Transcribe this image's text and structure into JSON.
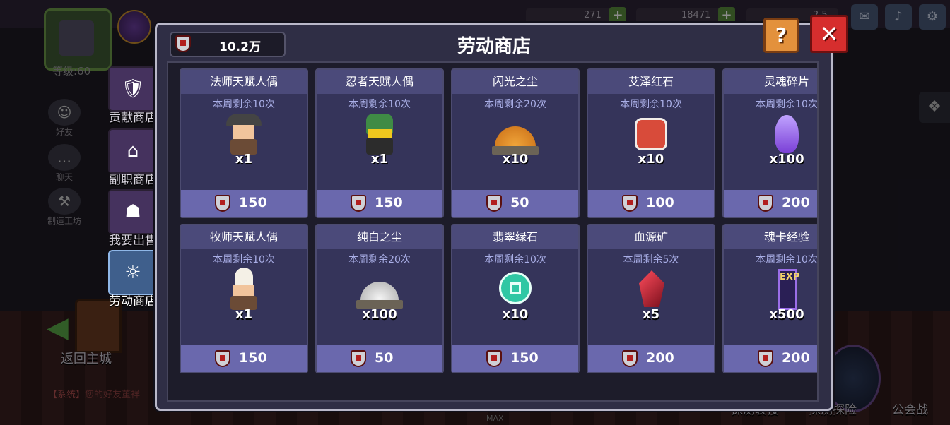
{
  "background": {
    "player": {
      "level_text": "等级:60"
    },
    "resources": [
      {
        "icon": "pink-gem-icon",
        "value": "271"
      },
      {
        "icon": "blue-gem-icon",
        "value": "18471"
      },
      {
        "icon": "gold-coin-icon",
        "value": "2.5"
      }
    ],
    "side_buttons_small": [
      {
        "id": "friends",
        "label": "好友",
        "icon": "friends-icon"
      },
      {
        "id": "chat",
        "label": "聊天",
        "icon": "chat-bubble-icon"
      },
      {
        "id": "workshop",
        "label": "制造工坊",
        "icon": "hammer-icon"
      }
    ],
    "back_label": "返回主城",
    "system_message": {
      "tag": "【系统】",
      "text": "您的好友董祥"
    },
    "bottom_tabs": [
      "探测装搜",
      "探测探险",
      "公会战"
    ],
    "max_label": "MAX"
  },
  "shop_nav": [
    {
      "label": "贡献商店",
      "icon": "contribution-shop-icon",
      "active": false
    },
    {
      "label": "副职商店",
      "icon": "side-job-shop-icon",
      "active": false
    },
    {
      "label": "我要出售",
      "icon": "sell-icon",
      "active": false
    },
    {
      "label": "劳动商店",
      "icon": "labor-shop-icon",
      "active": true
    }
  ],
  "shop": {
    "title": "劳动商店",
    "currency_value": "10.2万",
    "help_label": "?",
    "close_label": "✕",
    "items": [
      {
        "name": "法师天赋人偶",
        "limit": "本周剩余10次",
        "icon": "mage-doll-icon",
        "qty": "x1",
        "price": "150"
      },
      {
        "name": "忍者天赋人偶",
        "limit": "本周剩余10次",
        "icon": "ninja-doll-icon",
        "qty": "x1",
        "price": "150"
      },
      {
        "name": "闪光之尘",
        "limit": "本周剩余20次",
        "icon": "glitter-dust-icon",
        "qty": "x10",
        "price": "50"
      },
      {
        "name": "艾泽红石",
        "limit": "本周剩余10次",
        "icon": "red-stone-icon",
        "qty": "x10",
        "price": "100"
      },
      {
        "name": "灵魂碎片",
        "limit": "本周剩余10次",
        "icon": "soul-fragment-icon",
        "qty": "x100",
        "price": "200"
      },
      {
        "name": "牧师天赋人偶",
        "limit": "本周剩余10次",
        "icon": "priest-doll-icon",
        "qty": "x1",
        "price": "150"
      },
      {
        "name": "纯白之尘",
        "limit": "本周剩余20次",
        "icon": "white-dust-icon",
        "qty": "x100",
        "price": "50"
      },
      {
        "name": "翡翠绿石",
        "limit": "本周剩余10次",
        "icon": "emerald-stone-icon",
        "qty": "x10",
        "price": "150"
      },
      {
        "name": "血源矿",
        "limit": "本周剩余5次",
        "icon": "blood-ore-icon",
        "qty": "x5",
        "price": "200"
      },
      {
        "name": "魂卡经验",
        "limit": "本周剩余10次",
        "icon": "exp-card-icon",
        "qty": "x500",
        "price": "200",
        "icon_text": "EXP"
      }
    ]
  },
  "colors": {
    "panel_bg": "#2f2e45",
    "card_bg": "#35345a",
    "card_title_bg": "#4b4a7a",
    "price_bar": "#6a68ad",
    "limit_text": "#a9aee6",
    "help_button": "#e3913c",
    "close_button": "#d62e2e"
  }
}
